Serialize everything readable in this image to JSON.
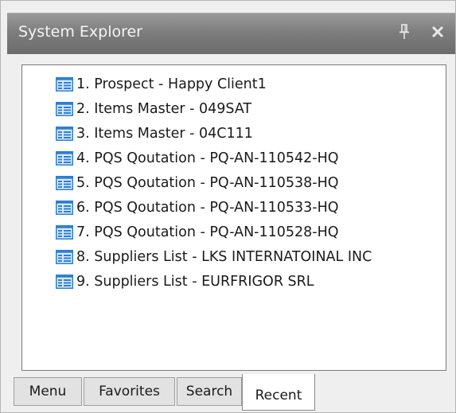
{
  "panel": {
    "title": "System Explorer",
    "pin_icon": "pin-icon",
    "close_icon": "close-icon"
  },
  "recent": {
    "item_icon": "list-form-icon",
    "items": [
      {
        "label": "1.  Prospect  - Happy Client1"
      },
      {
        "label": "2.  Items Master - 049SAT"
      },
      {
        "label": "3.  Items Master - 04C111"
      },
      {
        "label": "4.  PQS Qoutation - PQ-AN-110542-HQ"
      },
      {
        "label": "5.  PQS Qoutation - PQ-AN-110538-HQ"
      },
      {
        "label": "6.  PQS Qoutation - PQ-AN-110533-HQ"
      },
      {
        "label": "7.  PQS Qoutation - PQ-AN-110528-HQ"
      },
      {
        "label": "8.  Suppliers List - LKS INTERNATOINAL INC"
      },
      {
        "label": "9.  Suppliers List - EURFRIGOR SRL"
      }
    ]
  },
  "tabs": [
    {
      "label": "Menu",
      "active": false
    },
    {
      "label": "Favorites",
      "active": false
    },
    {
      "label": "Search",
      "active": false
    },
    {
      "label": "Recent",
      "active": true
    }
  ],
  "colors": {
    "titlebar": "#7c7c7c",
    "icon_blue": "#2f7fd0",
    "panel_bg": "#efefef"
  }
}
